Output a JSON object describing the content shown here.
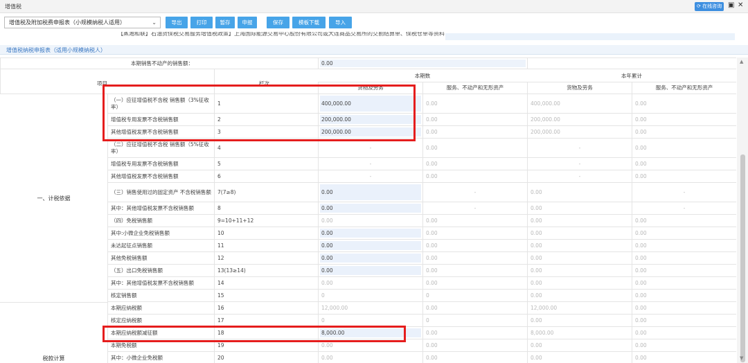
{
  "window": {
    "title": "增值税",
    "consult_label": "在线咨询"
  },
  "toolbar": {
    "form_select": "增值税及附加税费申报表（小规模纳税人适用）",
    "buttons": [
      "导出",
      "打印",
      "暂存",
      "申报",
      "保存",
      "模板下载",
      "导入"
    ]
  },
  "cut_text": "【蒸湘和联】石油货保税交易服务增值税政策】上海国际能源交易中心股份有限公司或大连商品交易所的交割结算单、保税仓单等资料",
  "section_title": "增值税纳税申报表（适用小规模纳税人）",
  "sales_row": {
    "label": "本期销售不动产的销售额：",
    "value": "0.00"
  },
  "headers": {
    "item": "项目",
    "col": "栏次",
    "current": "本期数",
    "ytd": "本年累计",
    "goods": "货物及劳务",
    "services": "服务、不动产和无形资产",
    "goods2": "货物及劳务",
    "services2": "服务、不动产和无形资产"
  },
  "groups": {
    "basis": "一、计税依据",
    "tax": "税款计算"
  },
  "rows": [
    {
      "item": "（一）应征增值税不含税 销售额（3%征收率）",
      "col": "1",
      "a": "400,000.00",
      "b": "0.00",
      "c": "400,000.00",
      "d": "0.00"
    },
    {
      "item": "增值税专用发票不含税销售额",
      "col": "2",
      "a": "200,000.00",
      "b": "0.00",
      "c": "200,000.00",
      "d": "0.00"
    },
    {
      "item": "其他增值税发票不含税销售额",
      "col": "3",
      "a": "200,000.00",
      "b": "0.00",
      "c": "200,000.00",
      "d": "0.00"
    },
    {
      "item": "（二）应征增值税不含税 销售额（5%征收率）",
      "col": "4",
      "a": "-",
      "b": "0.00",
      "c": "-",
      "d": "0.00"
    },
    {
      "item": "增值税专用发票不含税销售额",
      "col": "5",
      "a": "-",
      "b": "0.00",
      "c": "-",
      "d": "0.00"
    },
    {
      "item": "其他增值税发票不含税销售额",
      "col": "6",
      "a": "-",
      "b": "0.00",
      "c": "-",
      "d": "0.00"
    },
    {
      "item": "（三）销售使用过的固定资产 不含税销售额",
      "col": "7(7≥8)",
      "a": "0.00",
      "b": "-",
      "c": "0.00",
      "d": "-"
    },
    {
      "item": "其中：其他增值税发票不含税销售额",
      "col": "8",
      "a": "0.00",
      "b": "-",
      "c": "0.00",
      "d": "-"
    },
    {
      "item": "（四）免税销售额",
      "col": "9=10+11+12",
      "a": "0.00",
      "b": "0.00",
      "c": "0.00",
      "d": "0.00"
    },
    {
      "item": "其中:小微企业免税销售额",
      "col": "10",
      "a": "0.00",
      "b": "0.00",
      "c": "0.00",
      "d": "0.00"
    },
    {
      "item": "未达起征点销售额",
      "col": "11",
      "a": "0.00",
      "b": "0.00",
      "c": "0.00",
      "d": "0.00"
    },
    {
      "item": "其他免税销售额",
      "col": "12",
      "a": "0.00",
      "b": "0.00",
      "c": "0.00",
      "d": "0.00"
    },
    {
      "item": "（五）出口免税销售额",
      "col": "13(13≥14)",
      "a": "0.00",
      "b": "0.00",
      "c": "0.00",
      "d": "0.00"
    },
    {
      "item": "其中：其他增值税发票不含税销售额",
      "col": "14",
      "a": "0.00",
      "b": "0.00",
      "c": "0.00",
      "d": "0.00"
    },
    {
      "item": "核定销售额",
      "col": "15",
      "a": "0",
      "b": "0",
      "c": "0.00",
      "d": "0.00"
    },
    {
      "item": "本期应纳税额",
      "col": "16",
      "a": "12,000.00",
      "b": "0.00",
      "c": "12,000.00",
      "d": "0.00"
    },
    {
      "item": "核定应纳税额",
      "col": "17",
      "a": "0",
      "b": "0",
      "c": "0.00",
      "d": "0.00"
    },
    {
      "item": "本期应纳税额减征额",
      "col": "18",
      "a": "8,000.00",
      "b": "0.00",
      "c": "8,000.00",
      "d": "0.00"
    },
    {
      "item": "本期免税额",
      "col": "19",
      "a": "0.00",
      "b": "0.00",
      "c": "0.00",
      "d": "0.00"
    },
    {
      "item": "其中：小微企业免税额",
      "col": "20",
      "a": "0.00",
      "b": "0.00",
      "c": "0.00",
      "d": "0.00"
    }
  ]
}
